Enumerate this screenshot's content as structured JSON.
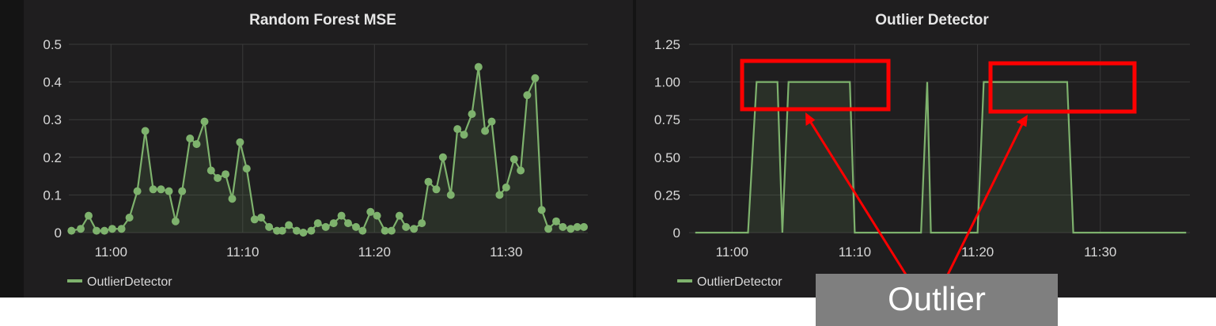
{
  "chart_data": [
    {
      "type": "line",
      "title": "Random Forest MSE",
      "xlabel": "",
      "ylabel": "",
      "x_ticks": [
        "11:00",
        "11:10",
        "11:20",
        "11:30"
      ],
      "y_ticks": [
        "0",
        "0.1",
        "0.2",
        "0.3",
        "0.4",
        "0.5"
      ],
      "ylim": [
        0,
        0.5
      ],
      "xlim_minutes": [
        56.8,
        96.2
      ],
      "grid": true,
      "legend_position": "bottom-left",
      "series": [
        {
          "name": "OutlierDetector",
          "color": "#7eb26d",
          "points": true,
          "fill": true,
          "x_minutes": [
            57.0,
            57.7,
            58.3,
            58.9,
            59.5,
            60.1,
            60.8,
            61.4,
            62.0,
            62.6,
            63.2,
            63.8,
            64.4,
            64.9,
            65.4,
            66.0,
            66.5,
            67.1,
            67.6,
            68.1,
            68.7,
            69.2,
            69.8,
            70.3,
            70.9,
            71.4,
            72.0,
            72.6,
            73.0,
            73.5,
            74.1,
            74.6,
            75.2,
            75.7,
            76.3,
            76.9,
            77.5,
            78.0,
            78.6,
            79.1,
            79.7,
            80.2,
            80.8,
            81.3,
            81.9,
            82.4,
            83.0,
            83.6,
            84.1,
            84.7,
            85.2,
            85.8,
            86.3,
            86.8,
            87.4,
            87.9,
            88.4,
            88.9,
            89.5,
            90.0,
            90.6,
            91.1,
            91.6,
            92.2,
            92.7,
            93.2,
            93.8,
            94.3,
            94.9,
            95.4,
            95.9
          ],
          "values": [
            0.005,
            0.01,
            0.045,
            0.005,
            0.005,
            0.01,
            0.01,
            0.04,
            0.11,
            0.27,
            0.115,
            0.115,
            0.11,
            0.03,
            0.11,
            0.25,
            0.235,
            0.295,
            0.165,
            0.145,
            0.155,
            0.09,
            0.24,
            0.17,
            0.035,
            0.04,
            0.015,
            0.005,
            0.005,
            0.02,
            0.005,
            0.0,
            0.005,
            0.025,
            0.015,
            0.025,
            0.045,
            0.025,
            0.015,
            0.005,
            0.055,
            0.045,
            0.005,
            0.005,
            0.045,
            0.015,
            0.01,
            0.025,
            0.135,
            0.115,
            0.2,
            0.1,
            0.275,
            0.26,
            0.315,
            0.44,
            0.27,
            0.295,
            0.1,
            0.12,
            0.195,
            0.165,
            0.365,
            0.41,
            0.06,
            0.01,
            0.03,
            0.015,
            0.01,
            0.015,
            0.015
          ]
        }
      ]
    },
    {
      "type": "area",
      "title": "Outlier Detector",
      "xlabel": "",
      "ylabel": "",
      "x_ticks": [
        "11:00",
        "11:10",
        "11:20",
        "11:30"
      ],
      "y_ticks": [
        "0",
        "0.25",
        "0.50",
        "0.75",
        "1.00",
        "1.25"
      ],
      "ylim": [
        0,
        1.25
      ],
      "xlim_minutes": [
        56.5,
        97.3
      ],
      "grid": true,
      "legend_position": "bottom-left",
      "series": [
        {
          "name": "OutlierDetector",
          "color": "#7eb26d",
          "points": false,
          "fill": true,
          "x_minutes": [
            57.0,
            61.3,
            62.0,
            63.7,
            64.1,
            64.6,
            69.6,
            70.0,
            75.4,
            75.9,
            76.2,
            77.5,
            78.1,
            80.0,
            80.5,
            87.3,
            87.8,
            97.0
          ],
          "values": [
            0,
            0,
            1,
            1,
            0,
            1,
            1,
            0,
            0,
            1,
            0,
            0,
            0,
            0,
            1,
            1,
            0,
            0
          ]
        }
      ]
    }
  ],
  "legend": {
    "label": "OutlierDetector"
  },
  "annotation": {
    "label": "Outlier",
    "color": "#ff0000"
  }
}
